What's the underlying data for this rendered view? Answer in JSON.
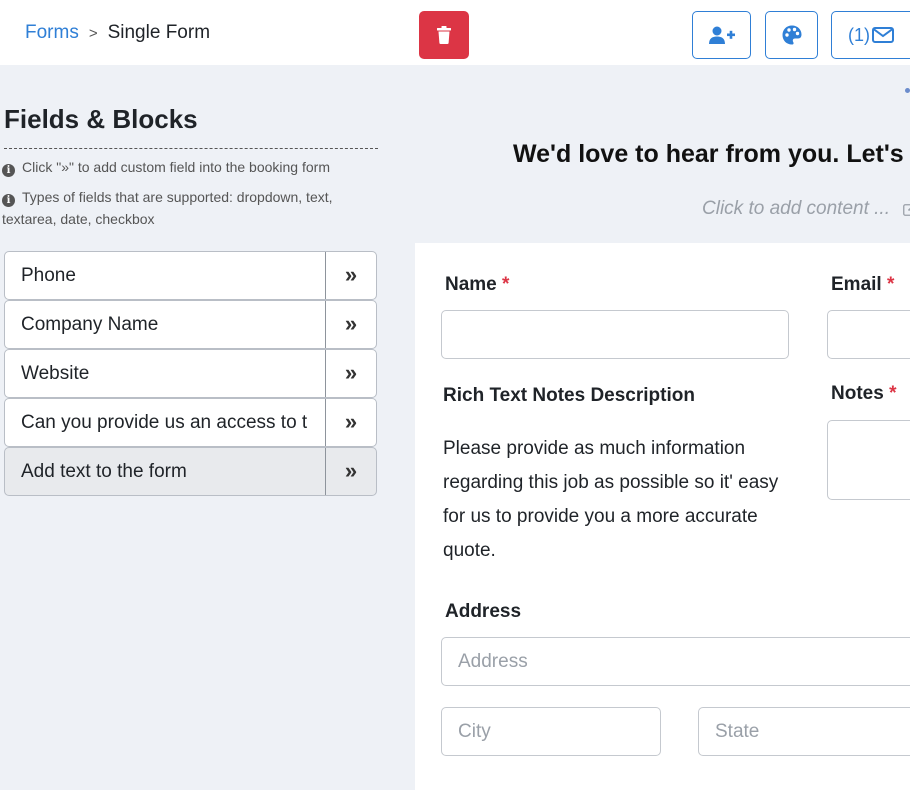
{
  "breadcrumb": {
    "parent": "Forms",
    "separator": ">",
    "current": "Single Form"
  },
  "toolbar": {
    "delete_icon": "trash-icon",
    "add_user_icon": "user-plus-icon",
    "palette_icon": "palette-icon",
    "email_label": "(1)",
    "email_icon": "envelope-icon"
  },
  "sidebar": {
    "title": "Fields & Blocks",
    "info_1": "Click \"»\" to add custom field into the booking form",
    "info_2": "Types of fields that are supported: dropdown, text, textarea, date, checkbox",
    "add_symbol": "»",
    "items": [
      {
        "label": "Phone"
      },
      {
        "label": "Company Name"
      },
      {
        "label": "Website"
      },
      {
        "label": "Can you provide us an access to t"
      },
      {
        "label": "Add text to the form"
      }
    ]
  },
  "form": {
    "heading": "We'd love to hear from you. Let's",
    "content_hint": "Click to add content ...",
    "required_mark": "*",
    "name_label": "Name",
    "email_label": "Email",
    "rich_text_label": "Rich Text Notes Description",
    "rich_text_body": "Please provide as much information regarding this job as possible so it' easy for us to provide you a more accurate quote.",
    "notes_label": "Notes",
    "address_label": "Address",
    "address_placeholder": "Address",
    "city_placeholder": "City",
    "state_placeholder": "State"
  },
  "colors": {
    "accent": "#2f7fd6",
    "danger": "#dc3545",
    "background": "#eef1f6"
  }
}
